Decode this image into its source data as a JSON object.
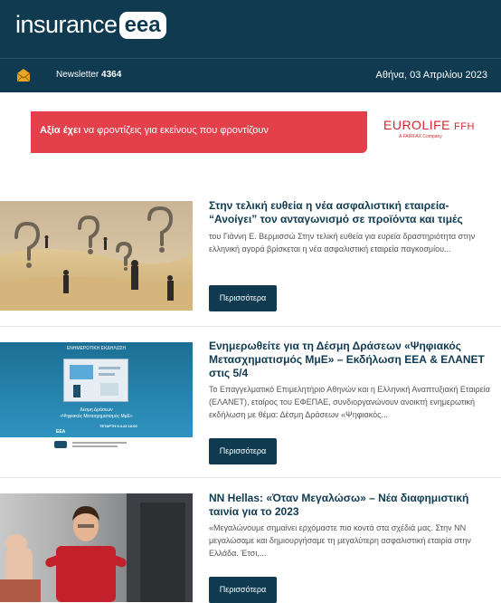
{
  "header": {
    "logo_text": "insurance",
    "logo_box": "eea"
  },
  "subbar": {
    "newsletter_label": "Newsletter",
    "newsletter_number": "4364",
    "date": "Αθήνα, 03 Απριλίου 2023"
  },
  "banner": {
    "text_bold": "Αξία έχει",
    "text_rest": "να φροντίζεις για εκείνους που φροντίζουν",
    "brand_main": "EUROLIFE",
    "brand_suffix": "FFH",
    "brand_sub": "A FAIRFAX Company"
  },
  "articles": [
    {
      "title": "Στην τελική ευθεία η νέα ασφαλιστική εταιρεία- “Ανοίγει” τον ανταγωνισμό σε προϊόντα και τιμές",
      "excerpt": "του Γιάννη Ε. Βερμισσώ Στην τελική ευθεία για ευρεία δραστηριότητα στην ελληνική αγορά βρίσκεται η νέα ασφαλιστική εταιρεία παγκοσμίου...",
      "more_label": "Περισσότερα"
    },
    {
      "title": "Ενημερωθείτε για τη Δέσμη Δράσεων «Ψηφιακός Μετασχηματισμός ΜμΕ» – Εκδήλωση ΕΕΑ & ΕΛΑΝΕΤ στις 5/4",
      "excerpt": "Το Επαγγελματικό Επιμελητήριο Αθηνών και η Ελληνική Αναπτυξιακή Εταιρεία (ΕΛΑΝΕΤ), εταίρος του ΕΦΕΠΑΕ, συνδιοργανώνουν ανοικτή ενημερωτική εκδήλωση με θέμα: Δέσμη Δράσεων «Ψηφιακός...",
      "more_label": "Περισσότερα",
      "thumb": {
        "header": "ΕΝΗΜΕΡΩΤΙΚΗ ΕΚΔΗΛΩΣΗ",
        "line1": "Δέσμη Δράσεων",
        "line2": "«Ψηφιακός Μετασχηματισμός ΜμΕ»",
        "when": "ΤΕΤΑΡΤΗ 5.4.23 16:00",
        "where": "ΕΕΑ"
      }
    },
    {
      "title": "NN Hellas: «Όταν Μεγαλώσω» – Νέα διαφημιστική ταινία για το 2023",
      "excerpt": "«Μεγαλώνουμε σημαίνει ερχόμαστε πιο κοντά στα σχέδιά μας. Στην NN μεγαλώσαμε και δημιουργήσαμε τη μεγαλύτερη ασφαλιστική εταιρία στην Ελλάδα. Έτσι,...",
      "more_label": "Περισσότερα"
    }
  ],
  "colors": {
    "primary": "#0f3a50",
    "banner_red": "#e4404c",
    "brand_red": "#d4282e"
  }
}
